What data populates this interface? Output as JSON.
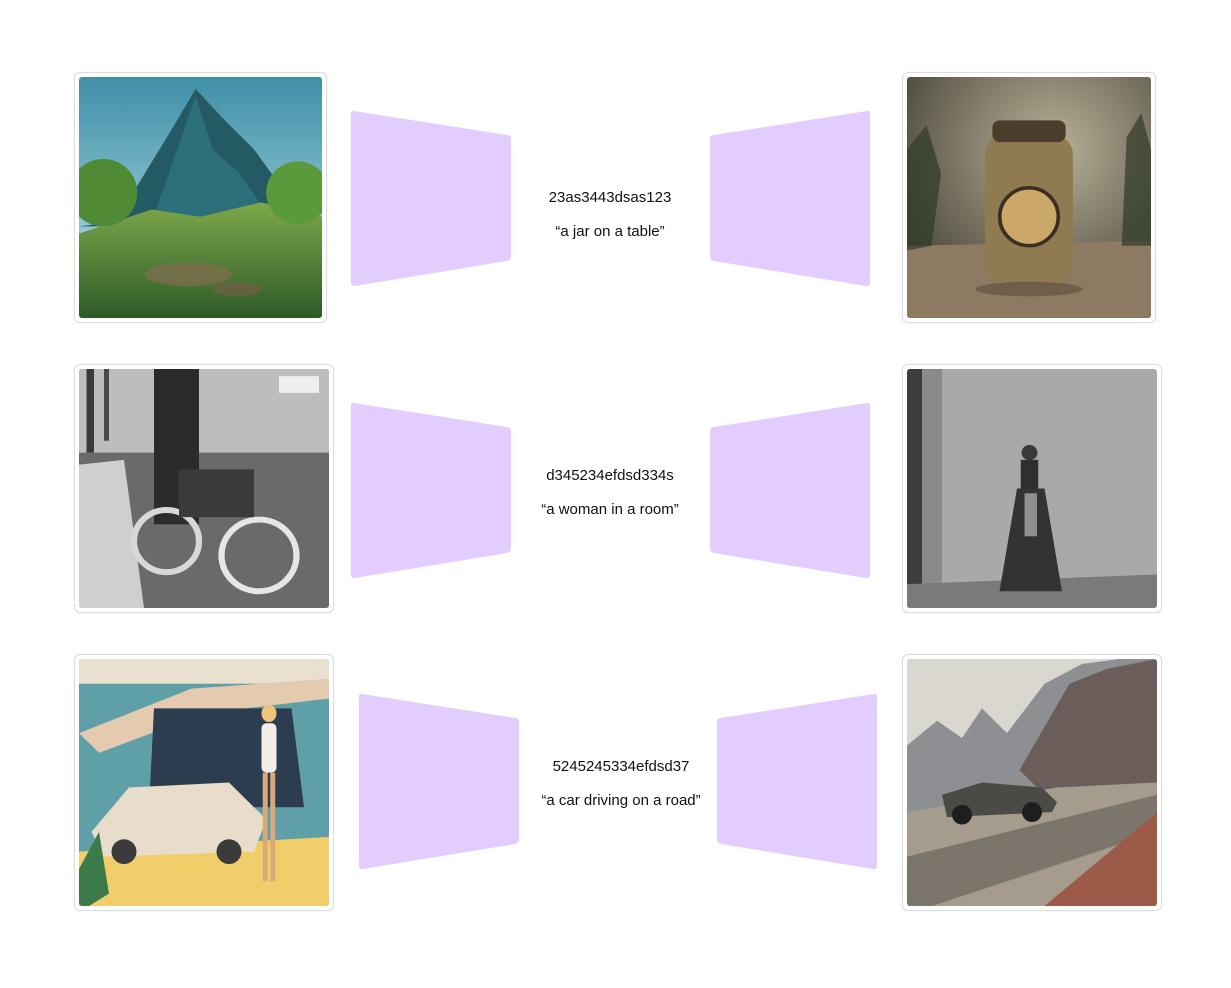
{
  "colors": {
    "encoder_fill": "#e3ccfe",
    "card_border": "#dcdcdc",
    "text": "#111111"
  },
  "rows": [
    {
      "latent_id": "23as3443dsas123",
      "prompt": "“a jar on a table”",
      "input_image": "mountain-landscape-image",
      "output_image": "jar-on-table-image"
    },
    {
      "latent_id": "d345234efdsd334s",
      "prompt": "“a woman in a room”",
      "input_image": "vintage-motorcycle-photo",
      "output_image": "woman-in-room-photo"
    },
    {
      "latent_id": "5245245334efdsd37",
      "prompt": "“a car driving on a road”",
      "input_image": "retro-car-and-woman-illustration",
      "output_image": "car-on-mountain-road-image"
    }
  ]
}
